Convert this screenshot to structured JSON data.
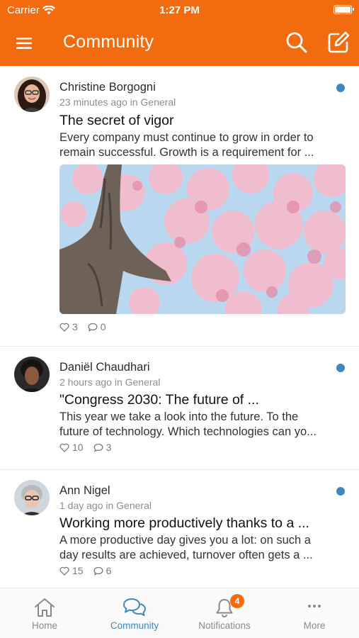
{
  "status_bar": {
    "carrier": "Carrier",
    "time": "1:27 PM"
  },
  "header": {
    "title": "Community",
    "background_color": "#F26B0F",
    "icons": [
      "menu-icon",
      "search-icon",
      "compose-icon"
    ]
  },
  "posts": [
    {
      "author": "Christine Borgogni",
      "meta": "23 minutes ago in General",
      "title": "The secret of vigor",
      "excerpt_line1": "Every company must continue to grow in order to",
      "excerpt_line2": "remain successful. Growth is a requirement for ...",
      "likes": "3",
      "comments": "0",
      "unread": true,
      "has_image": true
    },
    {
      "author": "Daniël Chaudhari",
      "meta": "2 hours ago in General",
      "title": "\"Congress 2030: The future of ...",
      "excerpt_line1": "This year we take a look into the future. To the",
      "excerpt_line2": "future of technology. Which technologies can yo...",
      "likes": "10",
      "comments": "3",
      "unread": true
    },
    {
      "author": "Ann Nigel",
      "meta": "1 day ago in General",
      "title": "Working more productively thanks to a ...",
      "excerpt_line1": "A more productive day gives you a lot: on such a",
      "excerpt_line2": "day results are achieved, turnover often gets a ...",
      "likes": "15",
      "comments": "6",
      "unread": true
    }
  ],
  "tabbar": {
    "tabs": [
      {
        "label": "Home",
        "icon": "home-icon",
        "active": false
      },
      {
        "label": "Community",
        "icon": "community-icon",
        "active": true
      },
      {
        "label": "Notifications",
        "icon": "bell-icon",
        "active": false,
        "badge": "4"
      },
      {
        "label": "More",
        "icon": "more-icon",
        "active": false
      }
    ],
    "active_color": "#3F87BE"
  }
}
